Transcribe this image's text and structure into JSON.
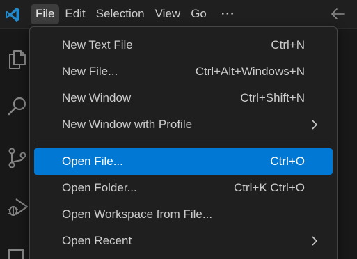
{
  "menubar": {
    "items": [
      {
        "label": "File",
        "active": true
      },
      {
        "label": "Edit"
      },
      {
        "label": "Selection"
      },
      {
        "label": "View"
      },
      {
        "label": "Go"
      }
    ],
    "more_label": "···"
  },
  "file_menu": {
    "group1": [
      {
        "label": "New Text File",
        "shortcut": "Ctrl+N"
      },
      {
        "label": "New File...",
        "shortcut": "Ctrl+Alt+Windows+N"
      },
      {
        "label": "New Window",
        "shortcut": "Ctrl+Shift+N"
      },
      {
        "label": "New Window with Profile",
        "submenu": true
      }
    ],
    "group2": [
      {
        "label": "Open File...",
        "shortcut": "Ctrl+O",
        "highlighted": true
      },
      {
        "label": "Open Folder...",
        "shortcut": "Ctrl+K Ctrl+O"
      },
      {
        "label": "Open Workspace from File..."
      },
      {
        "label": "Open Recent",
        "submenu": true
      }
    ]
  },
  "colors": {
    "accent": "#0078d4",
    "vscode_logo": "#2489ca",
    "menu_bg": "#1f1f1f",
    "menu_text": "#cccccc"
  },
  "icons": {
    "app": "vscode-logo-icon",
    "back": "arrow-left-icon",
    "activity": [
      "explorer-icon",
      "search-icon",
      "source-control-icon",
      "run-debug-icon",
      "extensions-icon"
    ]
  }
}
